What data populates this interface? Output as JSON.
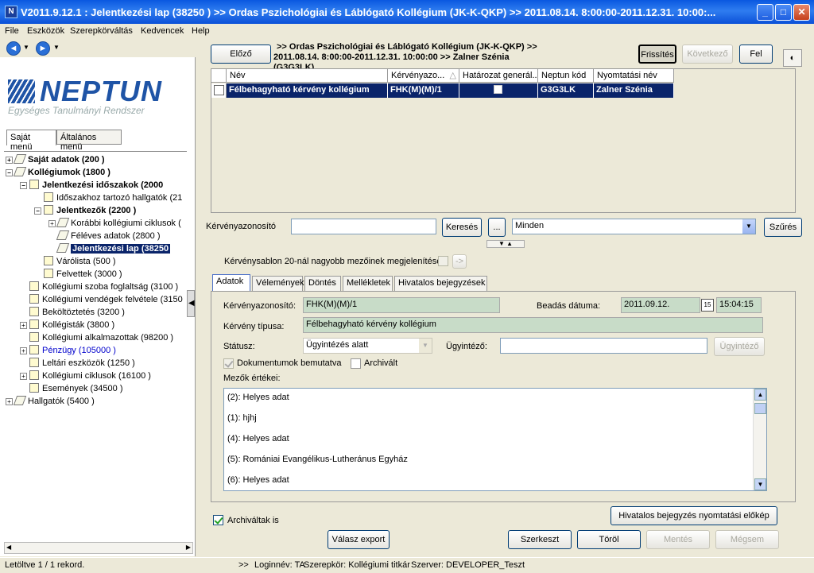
{
  "window": {
    "title": "V2011.9.12.1 : Jelentkezési lap (38250  ) >> Ordas Pszichológiai és Láblógató Kollégium (JK-K-QKP) >> 2011.08.14. 8:00:00-2011.12.31. 10:00:...",
    "icon_text": "N"
  },
  "menu": [
    "File",
    "Eszközök",
    "Szerepkörváltás",
    "Kedvencek",
    "Help"
  ],
  "nav": {
    "back": "◄",
    "forward": "►"
  },
  "logo": {
    "name": "NEPTUN",
    "subtitle": "Egységes Tanulmányi Rendszer"
  },
  "left_tabs": [
    "Saját menü",
    "Általános menü"
  ],
  "tree": [
    {
      "label": "Saját adatok (200  )",
      "level": 0,
      "exp": "+",
      "icon": "book",
      "bold": true
    },
    {
      "label": "Kollégiumok (1800  )",
      "level": 0,
      "exp": "-",
      "icon": "book",
      "bold": true
    },
    {
      "label": "Jelentkezési időszakok (2000",
      "level": 1,
      "exp": "-",
      "icon": "doc",
      "bold": true
    },
    {
      "label": "Időszakhoz tartozó hallgatók (21",
      "level": 2,
      "exp": "",
      "icon": "doc"
    },
    {
      "label": "Jelentkezők (2200  )",
      "level": 2,
      "exp": "-",
      "icon": "doc",
      "bold": true
    },
    {
      "label": "Korábbi kollégiumi ciklusok (",
      "level": 3,
      "exp": "+",
      "icon": "book"
    },
    {
      "label": "Féléves adatok (2800  )",
      "level": 3,
      "exp": "",
      "icon": "book"
    },
    {
      "label": "Jelentkezési lap (38250",
      "level": 3,
      "exp": "",
      "icon": "book",
      "selected": true
    },
    {
      "label": "Várólista (500  )",
      "level": 2,
      "exp": "",
      "icon": "doc"
    },
    {
      "label": "Felvettek (3000  )",
      "level": 2,
      "exp": "",
      "icon": "doc"
    },
    {
      "label": "Kollégiumi szoba foglaltság (3100  )",
      "level": 1,
      "exp": "",
      "icon": "doc"
    },
    {
      "label": "Kollégiumi vendégek felvétele (3150",
      "level": 1,
      "exp": "",
      "icon": "doc"
    },
    {
      "label": "Beköltöztetés (3200  )",
      "level": 1,
      "exp": "",
      "icon": "doc"
    },
    {
      "label": "Kollégisták (3800  )",
      "level": 1,
      "exp": "+",
      "icon": "doc"
    },
    {
      "label": "Kollégiumi alkalmazottak (98200  )",
      "level": 1,
      "exp": "",
      "icon": "doc"
    },
    {
      "label": "Pénzügy (105000  )",
      "level": 1,
      "exp": "+",
      "icon": "doc",
      "blue": true
    },
    {
      "label": "Leltári eszközök (1250  )",
      "level": 1,
      "exp": "",
      "icon": "doc"
    },
    {
      "label": "Kollégiumi ciklusok (16100  )",
      "level": 1,
      "exp": "+",
      "icon": "doc"
    },
    {
      "label": "Események (34500  )",
      "level": 1,
      "exp": "",
      "icon": "doc"
    },
    {
      "label": "Hallgatók (5400  )",
      "level": 0,
      "exp": "+",
      "icon": "book"
    }
  ],
  "top": {
    "prev": "Előző",
    "breadcrumb_line1": ">> Ordas Pszichológiai és Láblógató Kollégium (JK-K-QKP) >>",
    "breadcrumb_line2": "2011.08.14. 8:00:00-2011.12.31. 10:00:00 >> Zalner Szénia",
    "breadcrumb_line3": "(G3G3LK)",
    "refresh": "Frissítés",
    "next": "Következő",
    "up": "Fel"
  },
  "grid": {
    "headers": [
      "Név",
      "Kérvényazo...",
      "Határozat generál...",
      "Neptun kód",
      "Nyomtatási név"
    ],
    "sort_icon": "△",
    "row": [
      "Félbehagyható kérvény kollégium",
      "FHK(M)(M)/1",
      "",
      "G3G3LK",
      "Zalner Szénia"
    ]
  },
  "search": {
    "label": "Kérvényazonosító",
    "value": "",
    "search_btn": "Keresés",
    "more_btn": "...",
    "combo": "Minden",
    "filter_btn": "Szűrés"
  },
  "template_row": {
    "label": "Kérvénysablon 20-nál nagyobb mezőinek megjelenítése",
    "arrow": "->"
  },
  "tabs": [
    "Adatok",
    "Vélemények",
    "Döntés",
    "Mellékletek",
    "Hivatalos bejegyzések"
  ],
  "form": {
    "req_id_label": "Kérvényazonosító:",
    "req_id": "FHK(M)(M)/1",
    "submit_label": "Beadás dátuma:",
    "submit_date": "2011.09.12.",
    "cal_icon": "15",
    "submit_time": "15:04:15",
    "type_label": "Kérvény típusa:",
    "type": "Félbehagyható kérvény kollégium",
    "status_label": "Státusz:",
    "status": "Ügyintézés alatt",
    "admin_label": "Ügyintéző:",
    "admin": "",
    "admin_btn": "Ügyintéző",
    "docs_label": "Dokumentumok bemutatva",
    "archived_label": "Archivált",
    "fields_label": "Mezők értékei:",
    "fields": [
      "(2): Helyes adat",
      "(1): hjhj",
      "(4): Helyes adat",
      "(5):  Romániai Evangélikus-Lutheránus Egyház",
      "(6): Helyes adat"
    ]
  },
  "bottom": {
    "archived_too": "Archiváltak is",
    "print_btn": "Hivatalos bejegyzés nyomtatási előkép",
    "export": "Válasz export",
    "edit": "Szerkeszt",
    "delete": "Töröl",
    "save": "Mentés",
    "cancel": "Mégsem"
  },
  "status": {
    "left": "Letöltve 1 / 1 rekord.",
    "arrows": ">>",
    "login": "Loginnév: TA",
    "role": "Szerepkör: Kollégiumi titkár",
    "server": "Szerver: DEVELOPER_Teszt"
  }
}
